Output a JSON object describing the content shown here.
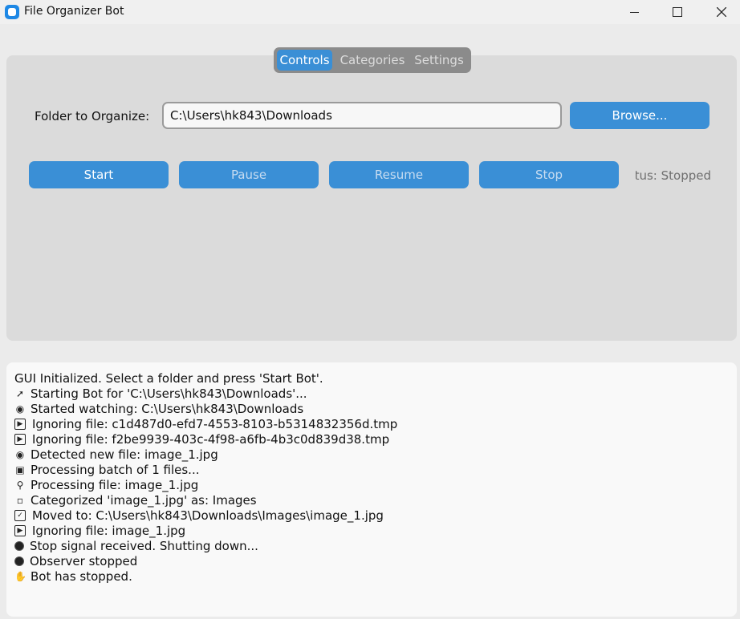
{
  "window": {
    "title": "File Organizer Bot"
  },
  "tabs": [
    {
      "label": "Controls",
      "active": true
    },
    {
      "label": "Categories",
      "active": false
    },
    {
      "label": "Settings",
      "active": false
    }
  ],
  "controls": {
    "folder_label": "Folder to Organize:",
    "folder_value": "C:\\Users\\hk843\\Downloads",
    "browse_label": "Browse...",
    "start_label": "Start",
    "pause_label": "Pause",
    "resume_label": "Resume",
    "stop_label": "Stop",
    "status_text": "Status: Stopped"
  },
  "log": [
    {
      "icon": "",
      "text": "GUI Initialized. Select a folder and press 'Start Bot'."
    },
    {
      "icon": "rocket-icon",
      "text": "Starting Bot for 'C:\\Users\\hk843\\Downloads'..."
    },
    {
      "icon": "eyes-icon",
      "text": "Started watching: C:\\Users\\hk843\\Downloads"
    },
    {
      "icon": "skip-icon",
      "text": "Ignoring file: c1d487d0-efd7-4553-8103-b5314832356d.tmp"
    },
    {
      "icon": "skip-icon",
      "text": "Ignoring file: f2be9939-403c-4f98-a6fb-4b3c0d839d38.tmp"
    },
    {
      "icon": "eyes-icon",
      "text": "Detected new file: image_1.jpg"
    },
    {
      "icon": "package-icon",
      "text": "Processing batch of 1 files..."
    },
    {
      "icon": "magnifier-icon",
      "text": "Processing file: image_1.jpg"
    },
    {
      "icon": "folder-icon",
      "text": "Categorized 'image_1.jpg' as: Images"
    },
    {
      "icon": "checkbox-icon",
      "text": "Moved to: C:\\Users\\hk843\\Downloads\\Images\\image_1.jpg"
    },
    {
      "icon": "skip-icon",
      "text": "Ignoring file: image_1.jpg"
    },
    {
      "icon": "stop-circle-icon",
      "text": "Stop signal received. Shutting down..."
    },
    {
      "icon": "stop-circle-icon",
      "text": "Observer stopped"
    },
    {
      "icon": "hand-icon",
      "text": "Bot has stopped."
    }
  ],
  "colors": {
    "accent": "#3a8fd6",
    "frame": "#dbdbdb",
    "log_bg": "#f9f9f9"
  }
}
